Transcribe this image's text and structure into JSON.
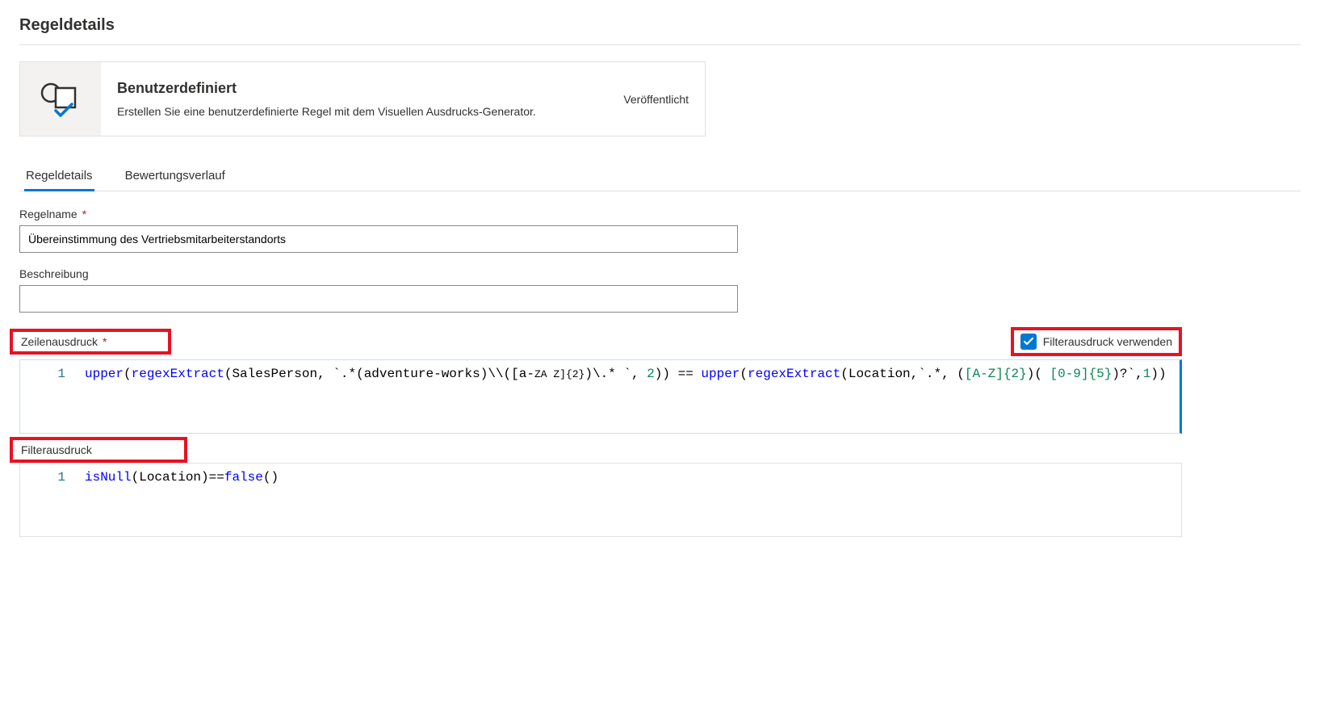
{
  "page": {
    "title": "Regeldetails"
  },
  "card": {
    "title": "Benutzerdefiniert",
    "desc": "Erstellen Sie eine benutzerdefinierte Regel mit dem Visuellen Ausdrucks-Generator.",
    "status": "Veröffentlicht"
  },
  "tabs": {
    "details": "Regeldetails",
    "history": "Bewertungsverlauf"
  },
  "form": {
    "ruleNameLabel": "Regelname",
    "ruleNameValue": "Übereinstimmung des Vertriebsmitarbeiterstandorts",
    "descriptionLabel": "Beschreibung",
    "descriptionValue": "",
    "rowExprLabel": "Zeilenausdruck",
    "filterCheckboxLabel": "Filterausdruck verwenden",
    "filterCheckboxChecked": true,
    "filterExprLabel": "Filterausdruck"
  },
  "rowExpr": {
    "lineNo": "1",
    "tokens": {
      "fn_upper1": "upper",
      "fn_regex1": "regexExtract",
      "var_sales": "SalesPerson",
      "str_pattern1_a": "`.*(adventure-works)\\\\(",
      "str_pattern1_b": "[a-",
      "str_pattern1_c": "ZA Z]{2}",
      "str_pattern1_d": ")\\.*     `",
      "num_2a": "2",
      "op_eq": " == ",
      "fn_upper2": "upper",
      "fn_regex2": "regexExtract",
      "var_loc": "Location",
      "str_pattern2_a": "`.*, (",
      "str_pattern2_b": "[A-Z]{2}",
      "str_pattern2_c": ")( ",
      "str_pattern2_d": "[0-9]{5}",
      "str_pattern2_e": ")?`",
      "num_1": "1"
    }
  },
  "filterExpr": {
    "lineNo": "1",
    "tokens": {
      "fn_isnull": "isNull",
      "var_loc": "Location",
      "op_eq": "==",
      "kw_false": "false"
    }
  }
}
